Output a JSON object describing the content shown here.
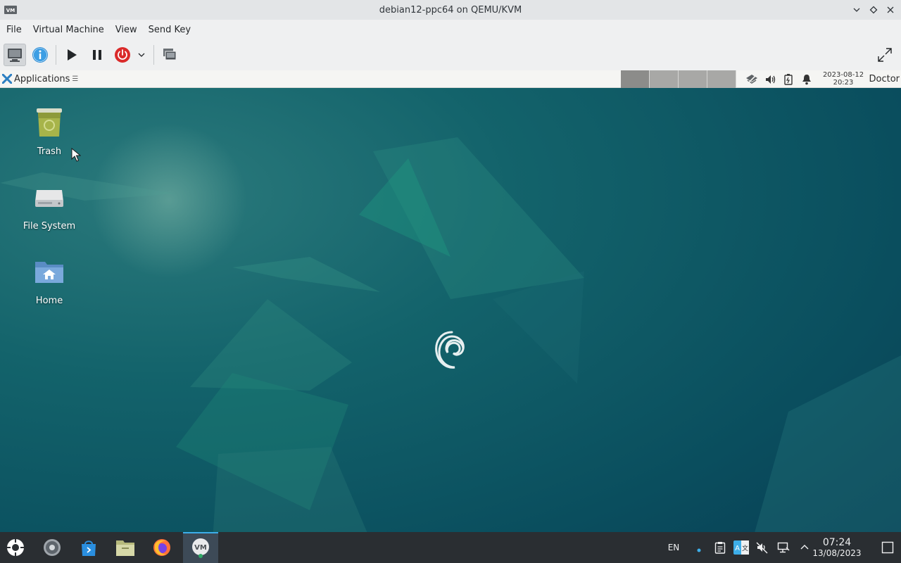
{
  "window": {
    "title": "debian12-ppc64 on QEMU/KVM",
    "controls": [
      "minimize",
      "maximize",
      "close"
    ]
  },
  "menubar": {
    "items": [
      "File",
      "Virtual Machine",
      "View",
      "Send Key"
    ]
  },
  "toolbar": {
    "buttons": [
      "console-icon",
      "info-icon",
      "play-icon",
      "pause-icon",
      "power-icon",
      "chevron-down-icon",
      "snapshot-icon"
    ],
    "fullscreen": "fullscreen-icon"
  },
  "guest": {
    "panel": {
      "applications_label": "Applications",
      "workspaces_count": 4,
      "active_workspace": 1,
      "clock_date": "2023-08-12",
      "clock_time": "20:23",
      "user": "Doctor"
    },
    "desktop": {
      "icons": [
        {
          "label": "Trash"
        },
        {
          "label": "File System"
        },
        {
          "label": "Home"
        }
      ]
    }
  },
  "taskbar": {
    "launchers": [
      "plasma-menu-icon",
      "settings-icon",
      "discover-icon",
      "files-icon",
      "firefox-icon",
      "virt-manager-icon"
    ],
    "active_launcher": "virt-manager-icon",
    "tray": {
      "language": "EN"
    },
    "clock": {
      "time": "07:24",
      "date": "13/08/2023"
    }
  },
  "colors": {
    "accent": "#3daee9",
    "taskbar_bg": "#2a2e32",
    "wallpaper_base": "#0b4f5d",
    "power_red": "#da2a2a",
    "info_blue": "#2f8ed6"
  }
}
